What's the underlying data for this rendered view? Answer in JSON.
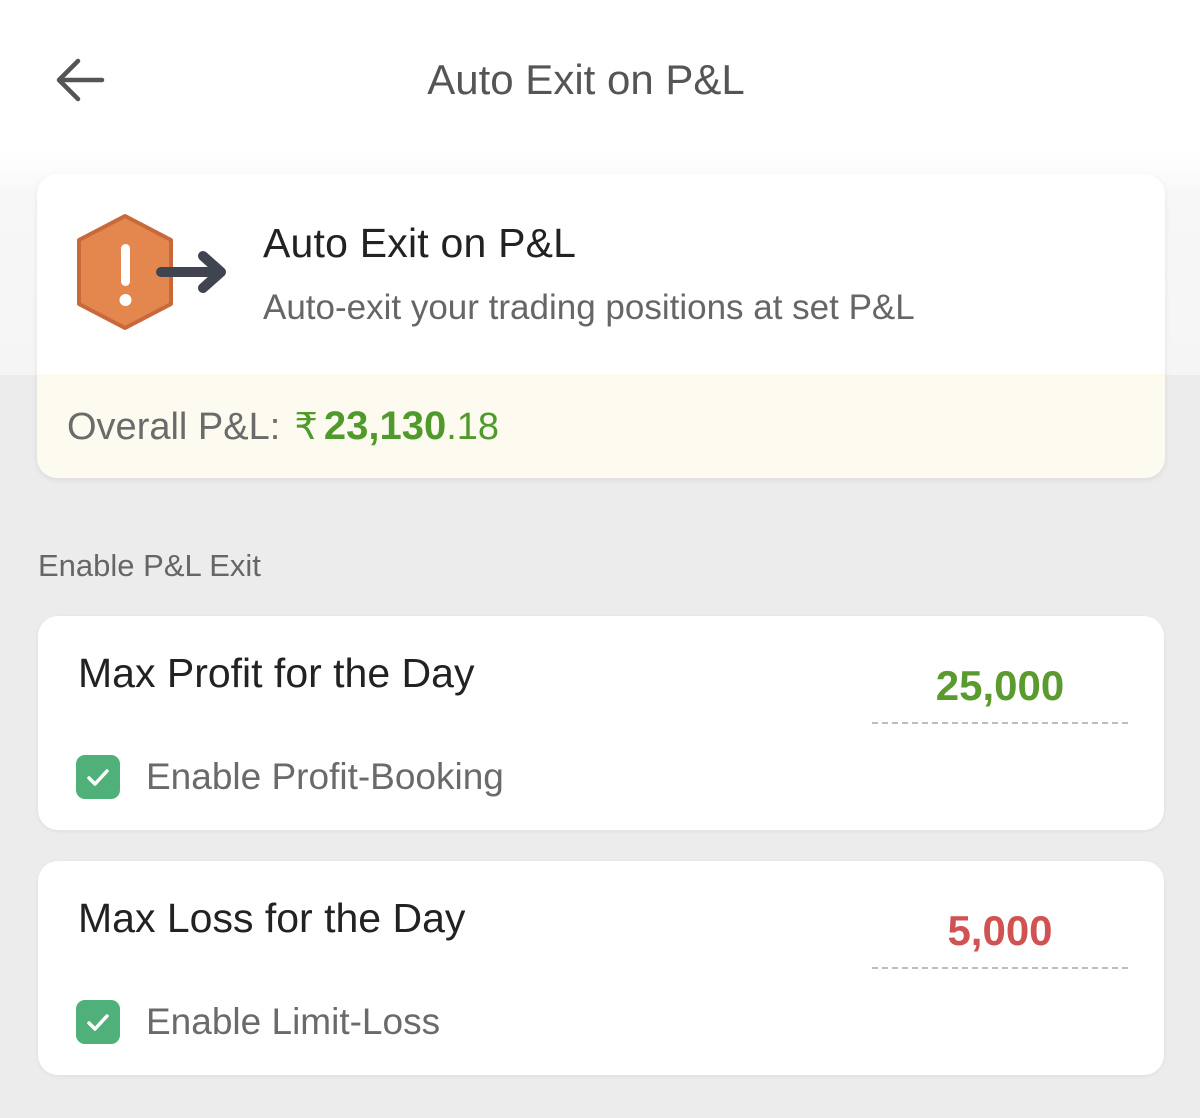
{
  "header": {
    "title": "Auto Exit on P&L"
  },
  "info": {
    "title": "Auto Exit on P&L",
    "subtitle": "Auto-exit your trading positions at set P&L",
    "pl_label": "Overall P&L:",
    "pl_currency": "₹",
    "pl_value_int": "23,130",
    "pl_value_dec": ".18"
  },
  "section": {
    "label": "Enable P&L Exit"
  },
  "profit": {
    "title": "Max Profit for the Day",
    "value": "25,000",
    "checkbox_label": "Enable Profit-Booking",
    "checked": true
  },
  "loss": {
    "title": "Max Loss for the Day",
    "value": "5,000",
    "checkbox_label": "Enable Limit-Loss",
    "checked": true
  },
  "colors": {
    "profit_green": "#5a9a2e",
    "loss_red": "#d05252",
    "checkbox_green": "#4fb07a",
    "warning_orange": "#e4874f",
    "pl_banner_bg": "#fdfbf0"
  },
  "icons": {
    "back": "arrow-left-icon",
    "warning": "warning-hexagon-exit-icon",
    "check": "check-icon"
  }
}
